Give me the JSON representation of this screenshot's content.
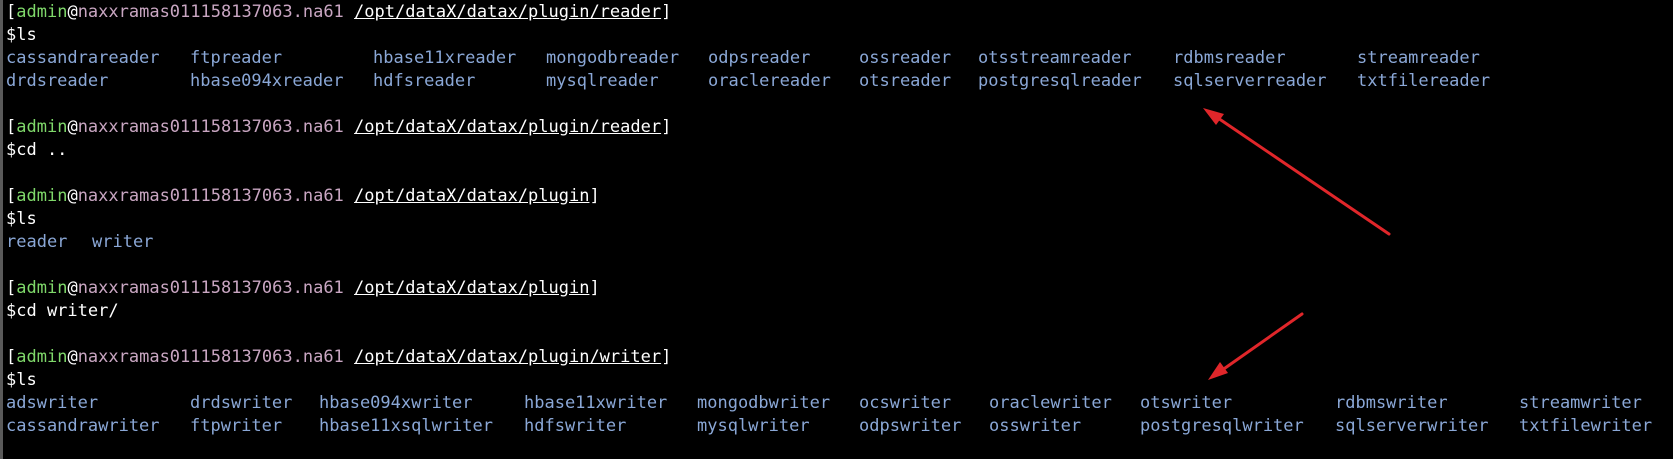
{
  "colors": {
    "background": "#000000",
    "user": "#7fd86a",
    "host": "#c9a6c2",
    "directory_listing": "#8aa7d6",
    "arrow": "#e0262a"
  },
  "blocks": [
    {
      "prompt": {
        "open": "[",
        "user": "admin",
        "at": "@",
        "host": "naxxramas011158137063.na61",
        "space": " ",
        "path": "/opt/dataX/datax/plugin/reader",
        "close": "]"
      },
      "command": "$ls",
      "listing": [
        [
          "cassandrareader",
          "ftpreader",
          "hbase11xreader",
          "mongodbreader",
          "odpsreader",
          "ossreader",
          "otsstreamreader",
          "rdbmsreader",
          "streamreader"
        ],
        [
          "drdsreader",
          "hbase094xreader",
          "hdfsreader",
          "mysqlreader",
          "oraclereader",
          "otsreader",
          "postgresqlreader",
          "sqlserverreader",
          "txtfilereader"
        ]
      ]
    },
    {
      "prompt": {
        "open": "[",
        "user": "admin",
        "at": "@",
        "host": "naxxramas011158137063.na61",
        "space": " ",
        "path": "/opt/dataX/datax/plugin/reader",
        "close": "]"
      },
      "command": "$cd ..",
      "listing": []
    },
    {
      "prompt": {
        "open": "[",
        "user": "admin",
        "at": "@",
        "host": "naxxramas011158137063.na61",
        "space": " ",
        "path": "/opt/dataX/datax/plugin",
        "close": "]"
      },
      "command": "$ls",
      "listing": [
        [
          "reader",
          "writer"
        ]
      ]
    },
    {
      "prompt": {
        "open": "[",
        "user": "admin",
        "at": "@",
        "host": "naxxramas011158137063.na61",
        "space": " ",
        "path": "/opt/dataX/datax/plugin",
        "close": "]"
      },
      "command": "$cd writer/",
      "listing": []
    },
    {
      "prompt": {
        "open": "[",
        "user": "admin",
        "at": "@",
        "host": "naxxramas011158137063.na61",
        "space": " ",
        "path": "/opt/dataX/datax/plugin/writer",
        "close": "]"
      },
      "command": "$ls",
      "listing": [
        [
          "adswriter",
          "drdswriter",
          "hbase094xwriter",
          "hbase11xwriter",
          "mongodbwriter",
          "ocswriter",
          "oraclewriter",
          "otswriter",
          "rdbmswriter",
          "streamwriter"
        ],
        [
          "cassandrawriter",
          "ftpwriter",
          "hbase11xsqlwriter",
          "hdfswriter",
          "mysqlwriter",
          "odpswriter",
          "osswriter",
          "postgresqlwriter",
          "sqlserverwriter",
          "txtfilewriter"
        ]
      ]
    }
  ]
}
